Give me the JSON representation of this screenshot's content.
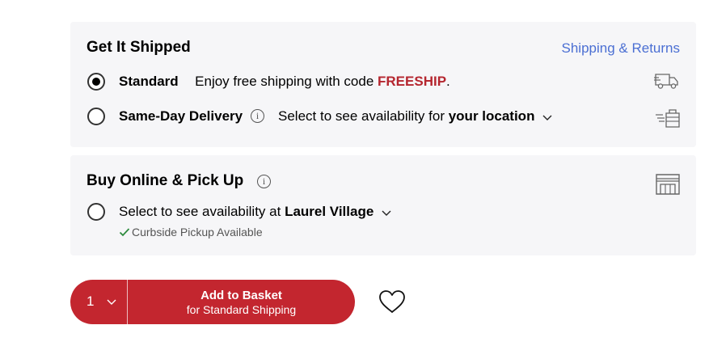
{
  "shipped": {
    "title": "Get It Shipped",
    "returns_link": "Shipping & Returns",
    "standard": {
      "label": "Standard",
      "text": "Enjoy free shipping with code ",
      "code": "FREESHIP",
      "suffix": ".",
      "selected": true,
      "icon": "delivery-truck-icon"
    },
    "same_day": {
      "label": "Same-Day Delivery",
      "text": "Select to see availability for ",
      "location": "your location",
      "selected": false,
      "icon": "fast-package-icon"
    }
  },
  "pickup": {
    "title": "Buy Online & Pick Up",
    "text": "Select to see availability at ",
    "store": "Laurel Village",
    "curbside": "Curbside Pickup Available",
    "selected": false,
    "icon": "store-icon"
  },
  "basket": {
    "quantity": "1",
    "add_label": "Add to Basket",
    "add_sub": "for Standard Shipping"
  },
  "colors": {
    "accent": "#c3262f",
    "link": "#4b6fd3",
    "panel": "#f6f6f8",
    "check": "#2e8b3e"
  }
}
